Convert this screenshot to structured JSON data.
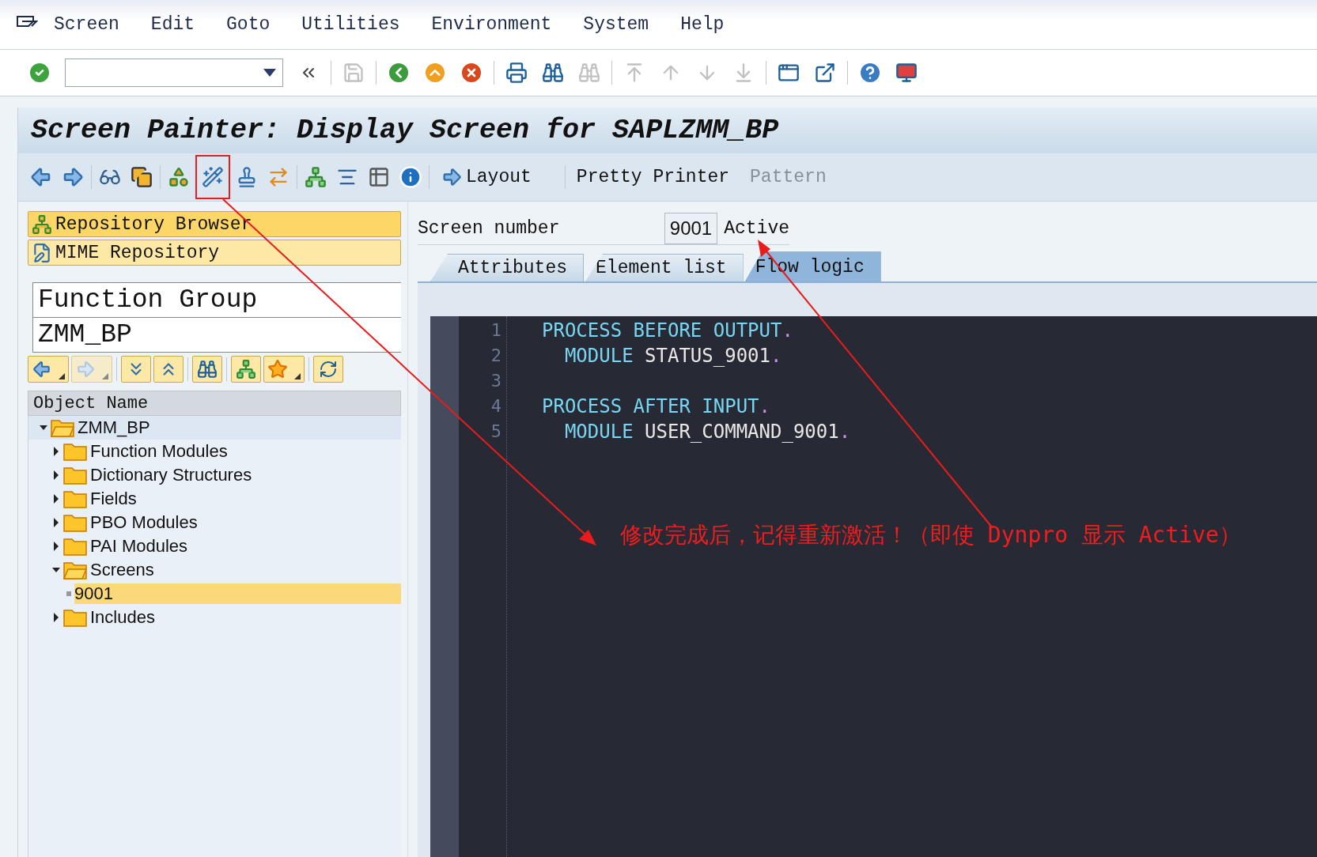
{
  "menu": [
    {
      "label": "Screen"
    },
    {
      "label": "Edit"
    },
    {
      "label": "Goto"
    },
    {
      "label": "Utilities"
    },
    {
      "label": "Environment"
    },
    {
      "label": "System"
    },
    {
      "label": "Help"
    }
  ],
  "toolbar": {
    "items": [
      {
        "kind": "enter",
        "disabled": false
      },
      {
        "kind": "command"
      },
      {
        "kind": "collapse",
        "disabled": false
      },
      {
        "kind": "save",
        "disabled": true
      },
      {
        "kind": "back",
        "disabled": false
      },
      {
        "kind": "exit",
        "disabled": false
      },
      {
        "kind": "cancel",
        "disabled": false
      },
      {
        "kind": "print",
        "disabled": false
      },
      {
        "kind": "find",
        "disabled": false
      },
      {
        "kind": "findnext",
        "disabled": true
      },
      {
        "kind": "first",
        "disabled": true
      },
      {
        "kind": "prev",
        "disabled": true
      },
      {
        "kind": "next",
        "disabled": true
      },
      {
        "kind": "last",
        "disabled": true
      },
      {
        "kind": "session",
        "disabled": false
      },
      {
        "kind": "shortcut",
        "disabled": false
      },
      {
        "kind": "help",
        "disabled": false
      },
      {
        "kind": "monitor",
        "disabled": false
      }
    ]
  },
  "title": "Screen Painter: Display Screen for SAPLZMM_BP",
  "app_toolbar": {
    "icons": [
      {
        "kind": "left",
        "marked": false
      },
      {
        "kind": "right",
        "marked": false
      },
      {
        "kind": "glasses",
        "marked": false
      },
      {
        "kind": "copy",
        "marked": false
      },
      {
        "kind": "shapes",
        "marked": false
      },
      {
        "kind": "wand",
        "marked": true
      },
      {
        "kind": "stamp",
        "marked": false
      },
      {
        "kind": "move",
        "marked": false
      },
      {
        "kind": "tree",
        "marked": false
      },
      {
        "kind": "align",
        "marked": false
      },
      {
        "kind": "table",
        "marked": false
      },
      {
        "kind": "info",
        "marked": false
      }
    ],
    "buttons": [
      {
        "label": "Layout",
        "disabled": false,
        "icon": true
      },
      {
        "label": "Pretty Printer",
        "disabled": false,
        "icon": false
      },
      {
        "label": "Pattern",
        "disabled": true,
        "icon": false
      }
    ]
  },
  "navigator": [
    {
      "label": "Repository Browser",
      "selected": true,
      "kind": "tree"
    },
    {
      "label": "MIME Repository",
      "selected": false,
      "kind": "mime"
    }
  ],
  "object_type": "Function Group",
  "object_name": "ZMM_BP",
  "tree_toolbar": [
    {
      "kind": "left",
      "disabled": false,
      "menu": true
    },
    {
      "kind": "right",
      "disabled": true,
      "menu": true
    },
    {
      "kind": "expand",
      "disabled": false,
      "menu": false
    },
    {
      "kind": "collapse",
      "disabled": false,
      "menu": false
    },
    {
      "kind": "find",
      "disabled": false,
      "menu": false
    },
    {
      "kind": "tree",
      "disabled": false,
      "menu": false
    },
    {
      "kind": "star",
      "disabled": false,
      "menu": true
    },
    {
      "kind": "refresh",
      "disabled": false,
      "menu": false
    }
  ],
  "tree": {
    "header": "Object Name",
    "items": [
      {
        "label": "ZMM_BP",
        "expanded": true,
        "selected": false,
        "children": [
          {
            "label": "Function Modules",
            "expanded": false,
            "selected": false
          },
          {
            "label": "Dictionary Structures",
            "expanded": false,
            "selected": false
          },
          {
            "label": "Fields",
            "expanded": false,
            "selected": false
          },
          {
            "label": "PBO Modules",
            "expanded": false,
            "selected": false
          },
          {
            "label": "PAI Modules",
            "expanded": false,
            "selected": false
          },
          {
            "label": "Screens",
            "expanded": true,
            "selected": false,
            "children": [
              {
                "label": "9001",
                "selected": true
              }
            ]
          },
          {
            "label": "Includes",
            "expanded": false,
            "selected": false
          }
        ]
      }
    ]
  },
  "screen": {
    "label": "Screen number",
    "number": "9001",
    "status": "Active"
  },
  "tabs": [
    {
      "label": "Attributes",
      "selected": false
    },
    {
      "label": "Element list",
      "selected": false
    },
    {
      "label": "Flow logic",
      "selected": true
    }
  ],
  "code": [
    {
      "number": "1",
      "tokens": [
        {
          "kind": "keyword",
          "text": "PROCESS BEFORE OUTPUT"
        },
        {
          "kind": "punct",
          "text": "."
        }
      ]
    },
    {
      "number": "2",
      "tokens": [
        {
          "kind": "keyword",
          "text": "  MODULE"
        },
        {
          "kind": "ident",
          "text": " STATUS_9001"
        },
        {
          "kind": "punct",
          "text": "."
        }
      ]
    },
    {
      "number": "3"
    },
    {
      "number": "4",
      "tokens": [
        {
          "kind": "keyword",
          "text": "PROCESS AFTER INPUT"
        },
        {
          "kind": "punct",
          "text": "."
        }
      ]
    },
    {
      "number": "5",
      "tokens": [
        {
          "kind": "keyword",
          "text": "  MODULE"
        },
        {
          "kind": "ident",
          "text": " USER_COMMAND_9001"
        },
        {
          "kind": "punct",
          "text": "."
        }
      ]
    }
  ],
  "annotation": "修改完成后，记得重新激活！（即使 Dynpro 显示 Active）"
}
